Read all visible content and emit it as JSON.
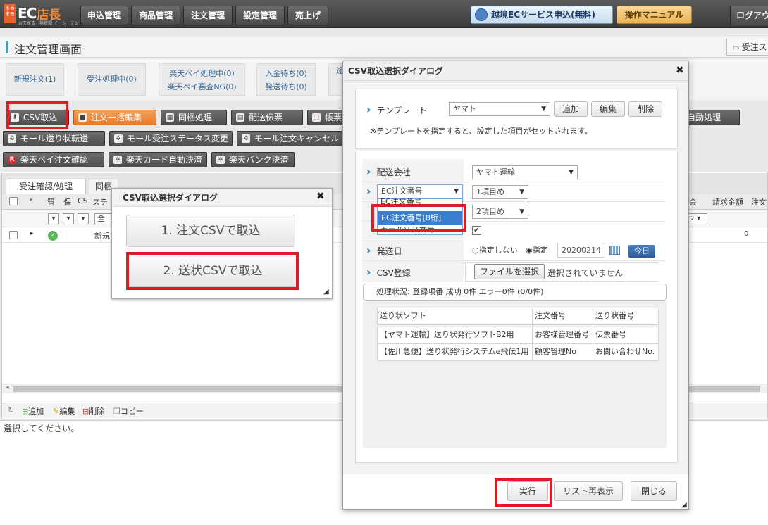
{
  "brand": {
    "mark": "まるまる",
    "ec": "EC",
    "tencho": "店長",
    "sub": "おてがる一括登録 イーシーテンチョウ"
  },
  "nav": {
    "items": [
      "申込管理",
      "商品管理",
      "注文管理",
      "設定管理",
      "売上げ"
    ],
    "cross_border": "越境ECサービス申込(無料)",
    "manual": "操作マニュアル",
    "logout": "ログアウ"
  },
  "page": {
    "title": "注文管理画面",
    "receive_btn": "受注ス"
  },
  "status": {
    "new": "新規注文(1)",
    "processing": "受注処理中(0)",
    "rakuten_pay_1": "楽天ペイ処理中(0)",
    "rakuten_pay_2": "楽天ペイ審査NG(0)",
    "payment_wait": "入金待ち(0)",
    "ship_wait": "発送待ち(0)",
    "more": "途"
  },
  "toolbar": {
    "csv_import": "CSV取込",
    "bulk_edit": "注文一括編集",
    "bundle": "同梱処理",
    "slip": "配送伝票",
    "invoice": "帳票",
    "auto": "自動処理",
    "mall_ship": "モール送り状転送",
    "mall_status": "モール受注ステータス変更",
    "mall_cancel": "モール注文キャンセル",
    "rakuten_pay_confirm": "楽天ペイ注文確認",
    "rakuten_card": "楽天カード自動決済",
    "rakuten_bank": "楽天バンク決済"
  },
  "grid": {
    "tab1": "受注確認/処理",
    "tab2": "同梱",
    "headers": {
      "kan": "管",
      "ho": "保",
      "cs": "CS",
      "su": "ステ",
      "kai": "会",
      "seikyu": "請求金額",
      "chu": "注文"
    },
    "filter_all": "全",
    "filter_ra": "ラ",
    "row_status": "新規",
    "row_amount": "0",
    "foot": {
      "add": "追加",
      "edit": "編集",
      "del": "削除",
      "copy": "コピー"
    },
    "message": "選択してください。"
  },
  "small_dialog": {
    "title": "CSV取込選択ダイアログ",
    "btn1": "1. 注文CSVで取込",
    "btn2": "2. 送状CSVで取込"
  },
  "big_dialog": {
    "title": "CSV取込選択ダイアログ",
    "template_label": "テンプレート",
    "template_value": "ヤマト",
    "add": "追加",
    "edit": "編集",
    "delete": "削除",
    "template_note": "※テンプレートを指定すると、設定した項目がセットされます。",
    "carrier_label": "配送会社",
    "carrier_value": "ヤマト運輸",
    "ec_select": "EC注文番号",
    "ec_option_1": "EC注文番号",
    "ec_option_2": "EC注文番号[8桁]",
    "ec_option_3": "モール注文番号",
    "item1": "1項目め",
    "item2": "2項目め",
    "ship_date_label": "発送日",
    "radio_none": "指定しない",
    "radio_set": "指定",
    "date_value": "20200214",
    "today": "今日",
    "csv_label": "CSV登録",
    "file_btn": "ファイルを選択",
    "file_none": "選択されていません",
    "proc_status": "処理状況: 登録項番 成功 0件 エラー0件 (0/0件)",
    "table": {
      "headers": [
        "送り状ソフト",
        "注文番号",
        "送り状番号"
      ],
      "rows": [
        [
          "【ヤマト運輸】送り状発行ソフトB2用",
          "お客様管理番号",
          "伝票番号"
        ],
        [
          "【佐川急便】送り状発行システムe飛伝1用",
          "顧客管理No",
          "お問い合わせNo."
        ]
      ]
    },
    "run": "実行",
    "reload": "リスト再表示",
    "close": "閉じる"
  }
}
